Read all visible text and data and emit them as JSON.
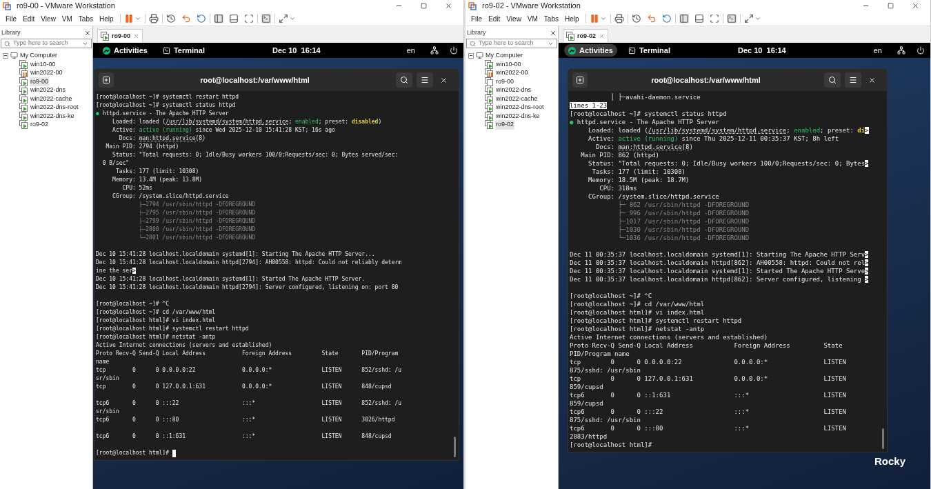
{
  "windows": [
    {
      "title": "ro9-00 - VMware Workstation",
      "menu": [
        "File",
        "Edit",
        "View",
        "VM",
        "Tabs",
        "Help"
      ],
      "library": {
        "title": "Library",
        "search_placeholder": "Type here to search",
        "root": {
          "label": "My Computer",
          "expanded": true,
          "children": [
            {
              "label": "win10-00",
              "selected": false,
              "kind": "running"
            },
            {
              "label": "win2022-00",
              "selected": false,
              "kind": "suspended"
            },
            {
              "label": "ro9-00",
              "selected": true,
              "kind": "running"
            },
            {
              "label": "win2022-dns",
              "selected": false,
              "kind": "running"
            },
            {
              "label": "win2022-cache",
              "selected": false,
              "kind": "running"
            },
            {
              "label": "win2022-dns-root",
              "selected": false,
              "kind": "running"
            },
            {
              "label": "win2022-dns-ke",
              "selected": false,
              "kind": "running"
            },
            {
              "label": "ro9-02",
              "selected": false,
              "kind": "running"
            }
          ]
        }
      },
      "tabs": [
        {
          "label": "ro9-00",
          "selected": true
        }
      ],
      "topbar": {
        "activities": "Activities",
        "activities_highlighted": false,
        "app": "Terminal",
        "clock": "Dec 10  16:14",
        "lang": "en"
      },
      "terminal": {
        "title": "root@localhost:/var/www/html",
        "lines": [
          {
            "kind": "plain",
            "text": "[root@localhost ~]# systemctl restart httpd"
          },
          {
            "kind": "plain",
            "text": "[root@localhost ~]# systemctl status httpd"
          },
          {
            "kind": "mixed",
            "parts": [
              {
                "kind": "good",
                "text": "●"
              },
              {
                "kind": "plain",
                "text": " httpd.service - The Apache HTTP Server"
              }
            ]
          },
          {
            "kind": "mixed",
            "parts": [
              {
                "kind": "plain",
                "text": "     Loaded: loaded ("
              },
              {
                "kind": "link",
                "text": "/usr/lib/systemd/system/httpd.service"
              },
              {
                "kind": "plain",
                "text": "; "
              },
              {
                "kind": "good",
                "text": "enabled"
              },
              {
                "kind": "plain",
                "text": "; preset: "
              },
              {
                "kind": "warn",
                "text": "disabled"
              },
              {
                "kind": "plain",
                "text": ")"
              }
            ]
          },
          {
            "kind": "mixed",
            "parts": [
              {
                "kind": "plain",
                "text": "     Active: "
              },
              {
                "kind": "good",
                "text": "active (running)"
              },
              {
                "kind": "plain",
                "text": " since Wed 2025-12-10 15:41:28 KST; 16s ago"
              }
            ]
          },
          {
            "kind": "mixed",
            "parts": [
              {
                "kind": "plain",
                "text": "       Docs: "
              },
              {
                "kind": "link",
                "text": "man:httpd.service(8)"
              }
            ]
          },
          {
            "kind": "plain",
            "text": "   Main PID: 2794 (httpd)"
          },
          {
            "kind": "plain",
            "text": "     Status: \"Total requests: 0; Idle/Busy workers 100/0;Requests/sec: 0; Bytes served/sec:"
          },
          {
            "kind": "plain",
            "text": "  0 B/sec\""
          },
          {
            "kind": "plain",
            "text": "      Tasks: 177 (limit: 10308)"
          },
          {
            "kind": "plain",
            "text": "     Memory: 13.4M (peak: 13.8M)"
          },
          {
            "kind": "plain",
            "text": "        CPU: 52ms"
          },
          {
            "kind": "plain",
            "text": "     CGroup: /system.slice/httpd.service"
          },
          {
            "kind": "dim",
            "text": "             ├─2794 /usr/sbin/httpd -DFOREGROUND"
          },
          {
            "kind": "dim",
            "text": "             ├─2795 /usr/sbin/httpd -DFOREGROUND"
          },
          {
            "kind": "dim",
            "text": "             ├─2799 /usr/sbin/httpd -DFOREGROUND"
          },
          {
            "kind": "dim",
            "text": "             ├─2800 /usr/sbin/httpd -DFOREGROUND"
          },
          {
            "kind": "dim",
            "text": "             └─2801 /usr/sbin/httpd -DFOREGROUND"
          },
          {
            "kind": "blank"
          },
          {
            "kind": "plain",
            "text": "Dec 10 15:41:28 localhost.localdomain systemd[1]: Starting The Apache HTTP Server..."
          },
          {
            "kind": "plain",
            "text": "Dec 10 15:41:28 localhost.localdomain httpd[2794]: AH00558: httpd: Could not reliably determ"
          },
          {
            "kind": "mixed",
            "parts": [
              {
                "kind": "plain",
                "text": "ine the ser"
              },
              {
                "kind": "reverse",
                "text": ">"
              }
            ]
          },
          {
            "kind": "plain",
            "text": "Dec 10 15:41:28 localhost.localdomain systemd[1]: Started The Apache HTTP Server."
          },
          {
            "kind": "plain",
            "text": "Dec 10 15:41:28 localhost.localdomain httpd[2794]: Server configured, listening on: port 80"
          },
          {
            "kind": "blank"
          },
          {
            "kind": "plain",
            "text": "[root@localhost ~]# ^C"
          },
          {
            "kind": "plain",
            "text": "[root@localhost ~]# cd /var/www/html"
          },
          {
            "kind": "plain",
            "text": "[root@localhost html]# vi index.html"
          },
          {
            "kind": "plain",
            "text": "[root@localhost html]# systemctl restart httpd"
          },
          {
            "kind": "plain",
            "text": "[root@localhost html]# netstat -antp"
          },
          {
            "kind": "plain",
            "text": "Active Internet connections (servers and established)"
          },
          {
            "kind": "plain",
            "text": "Proto Recv-Q Send-Q Local Address           Foreign Address         State       PID/Program"
          },
          {
            "kind": "plain",
            "text": "name"
          },
          {
            "kind": "plain",
            "text": "tcp        0      0 0.0.0.0:22              0.0.0.0:*               LISTEN      852/sshd: /u"
          },
          {
            "kind": "plain",
            "text": "sr/sbin"
          },
          {
            "kind": "plain",
            "text": "tcp        0      0 127.0.0.1:631           0.0.0.0:*               LISTEN      848/cupsd"
          },
          {
            "kind": "blank"
          },
          {
            "kind": "plain",
            "text": "tcp6       0      0 :::22                   :::*                    LISTEN      852/sshd: /u"
          },
          {
            "kind": "plain",
            "text": "sr/sbin"
          },
          {
            "kind": "plain",
            "text": "tcp6       0      0 :::80                   :::*                    LISTEN      3026/httpd"
          },
          {
            "kind": "blank"
          },
          {
            "kind": "plain",
            "text": "tcp6       0      0 ::1:631                 :::*                    LISTEN      848/cupsd"
          },
          {
            "kind": "blank"
          },
          {
            "kind": "mixed",
            "parts": [
              {
                "kind": "plain",
                "text": "[root@localhost html]# "
              },
              {
                "kind": "cursor"
              }
            ]
          }
        ]
      }
    },
    {
      "title": "ro9-02 - VMware Workstation",
      "menu": [
        "File",
        "Edit",
        "View",
        "VM",
        "Tabs",
        "Help"
      ],
      "library": {
        "title": "Library",
        "search_placeholder": "Type here to search",
        "root": {
          "label": "My Computer",
          "expanded": true,
          "children": [
            {
              "label": "win10-00",
              "selected": false,
              "kind": "running"
            },
            {
              "label": "win2022-00",
              "selected": false,
              "kind": "suspended"
            },
            {
              "label": "ro9-00",
              "selected": false,
              "kind": "off"
            },
            {
              "label": "win2022-dns",
              "selected": false,
              "kind": "running"
            },
            {
              "label": "win2022-cache",
              "selected": false,
              "kind": "running"
            },
            {
              "label": "win2022-dns-root",
              "selected": false,
              "kind": "running"
            },
            {
              "label": "win2022-dns-ke",
              "selected": false,
              "kind": "running"
            },
            {
              "label": "ro9-02",
              "selected": true,
              "kind": "running"
            }
          ]
        }
      },
      "tabs": [
        {
          "label": "ro9-02",
          "selected": true
        }
      ],
      "topbar": {
        "activities": "Activities",
        "activities_highlighted": true,
        "app": "Terminal",
        "clock": "Dec 10  16:14",
        "lang": "en"
      },
      "terminal": {
        "title": "root@localhost:/var/www/html",
        "lines": [
          {
            "kind": "plain",
            "text": "           │ ├─avahi-daemon.service"
          },
          {
            "kind": "mixed",
            "parts": [
              {
                "kind": "reverse",
                "text": "lines 1-23"
              }
            ]
          },
          {
            "kind": "plain",
            "text": "[root@localhost ~]# systemctl status httpd"
          },
          {
            "kind": "mixed",
            "parts": [
              {
                "kind": "good",
                "text": "●"
              },
              {
                "kind": "plain",
                "text": " httpd.service - The Apache HTTP Server"
              }
            ]
          },
          {
            "kind": "mixed",
            "parts": [
              {
                "kind": "plain",
                "text": "     Loaded: loaded ("
              },
              {
                "kind": "link",
                "text": "/usr/lib/systemd/system/httpd.service"
              },
              {
                "kind": "plain",
                "text": "; "
              },
              {
                "kind": "good",
                "text": "enabled"
              },
              {
                "kind": "plain",
                "text": "; preset: "
              },
              {
                "kind": "warn",
                "text": "di"
              },
              {
                "kind": "reverse",
                "text": ">"
              }
            ]
          },
          {
            "kind": "mixed",
            "parts": [
              {
                "kind": "plain",
                "text": "     Active: "
              },
              {
                "kind": "good",
                "text": "active (running)"
              },
              {
                "kind": "plain",
                "text": " since Thu 2025-12-11 00:35:37 KST; 8h left"
              }
            ]
          },
          {
            "kind": "mixed",
            "parts": [
              {
                "kind": "plain",
                "text": "       Docs: "
              },
              {
                "kind": "link",
                "text": "man:httpd.service(8)"
              }
            ]
          },
          {
            "kind": "plain",
            "text": "   Main PID: 862 (httpd)"
          },
          {
            "kind": "mixed",
            "parts": [
              {
                "kind": "plain",
                "text": "     Status: \"Total requests: 0; Idle/Busy workers 100/0;Requests/sec: 0; Bytes"
              },
              {
                "kind": "reverse",
                "text": ">"
              }
            ]
          },
          {
            "kind": "plain",
            "text": "      Tasks: 177 (limit: 10308)"
          },
          {
            "kind": "plain",
            "text": "     Memory: 18.5M (peak: 18.7M)"
          },
          {
            "kind": "plain",
            "text": "        CPU: 318ms"
          },
          {
            "kind": "plain",
            "text": "     CGroup: /system.slice/httpd.service"
          },
          {
            "kind": "dim",
            "text": "             ├─ 862 /usr/sbin/httpd -DFOREGROUND"
          },
          {
            "kind": "dim",
            "text": "             ├─ 996 /usr/sbin/httpd -DFOREGROUND"
          },
          {
            "kind": "dim",
            "text": "             ├─1017 /usr/sbin/httpd -DFOREGROUND"
          },
          {
            "kind": "dim",
            "text": "             ├─1030 /usr/sbin/httpd -DFOREGROUND"
          },
          {
            "kind": "dim",
            "text": "             └─1036 /usr/sbin/httpd -DFOREGROUND"
          },
          {
            "kind": "blank"
          },
          {
            "kind": "mixed",
            "parts": [
              {
                "kind": "plain",
                "text": "Dec 11 00:35:37 localhost.localdomain systemd[1]: Starting The Apache HTTP Serv"
              },
              {
                "kind": "reverse",
                "text": ">"
              }
            ]
          },
          {
            "kind": "mixed",
            "parts": [
              {
                "kind": "plain",
                "text": "Dec 11 00:35:37 localhost.localdomain httpd[862]: AH00558: httpd: Could not rel"
              },
              {
                "kind": "reverse",
                "text": ">"
              }
            ]
          },
          {
            "kind": "mixed",
            "parts": [
              {
                "kind": "plain",
                "text": "Dec 11 00:35:37 localhost.localdomain systemd[1]: Started The Apache HTTP Serve"
              },
              {
                "kind": "reverse",
                "text": ">"
              }
            ]
          },
          {
            "kind": "mixed",
            "parts": [
              {
                "kind": "plain",
                "text": "Dec 11 00:35:37 localhost.localdomain httpd[862]: Server configured, listening "
              },
              {
                "kind": "reverse",
                "text": ">"
              }
            ]
          },
          {
            "kind": "blank"
          },
          {
            "kind": "plain",
            "text": "[root@localhost ~]# ^C"
          },
          {
            "kind": "plain",
            "text": "[root@localhost ~]# cd /var/www/html"
          },
          {
            "kind": "plain",
            "text": "[root@localhost html]# vi index.html"
          },
          {
            "kind": "plain",
            "text": "[root@localhost html]# systemctl restart httpd"
          },
          {
            "kind": "plain",
            "text": "[root@localhost html]# netstat -antp"
          },
          {
            "kind": "plain",
            "text": "Active Internet connections (servers and established)"
          },
          {
            "kind": "plain",
            "text": "Proto Recv-Q Send-Q Local Address           Foreign Address         State"
          },
          {
            "kind": "plain",
            "text": "PID/Program name"
          },
          {
            "kind": "plain",
            "text": "tcp        0      0 0.0.0.0:22              0.0.0.0:*               LISTEN"
          },
          {
            "kind": "plain",
            "text": "875/sshd: /usr/sbin"
          },
          {
            "kind": "plain",
            "text": "tcp        0      0 127.0.0.1:631           0.0.0.0:*               LISTEN"
          },
          {
            "kind": "plain",
            "text": "859/cupsd"
          },
          {
            "kind": "plain",
            "text": "tcp6       0      0 ::1:631                 :::*                    LISTEN"
          },
          {
            "kind": "plain",
            "text": "859/cupsd"
          },
          {
            "kind": "plain",
            "text": "tcp6       0      0 :::22                   :::*                    LISTEN"
          },
          {
            "kind": "plain",
            "text": "875/sshd: /usr/sbin"
          },
          {
            "kind": "plain",
            "text": "tcp6       0      0 :::80                   :::*                    LISTEN"
          },
          {
            "kind": "plain",
            "text": "2883/httpd"
          },
          {
            "kind": "plain",
            "text": "[root@localhost html]#"
          }
        ]
      },
      "wallpaper_logo": "Rocky"
    }
  ]
}
